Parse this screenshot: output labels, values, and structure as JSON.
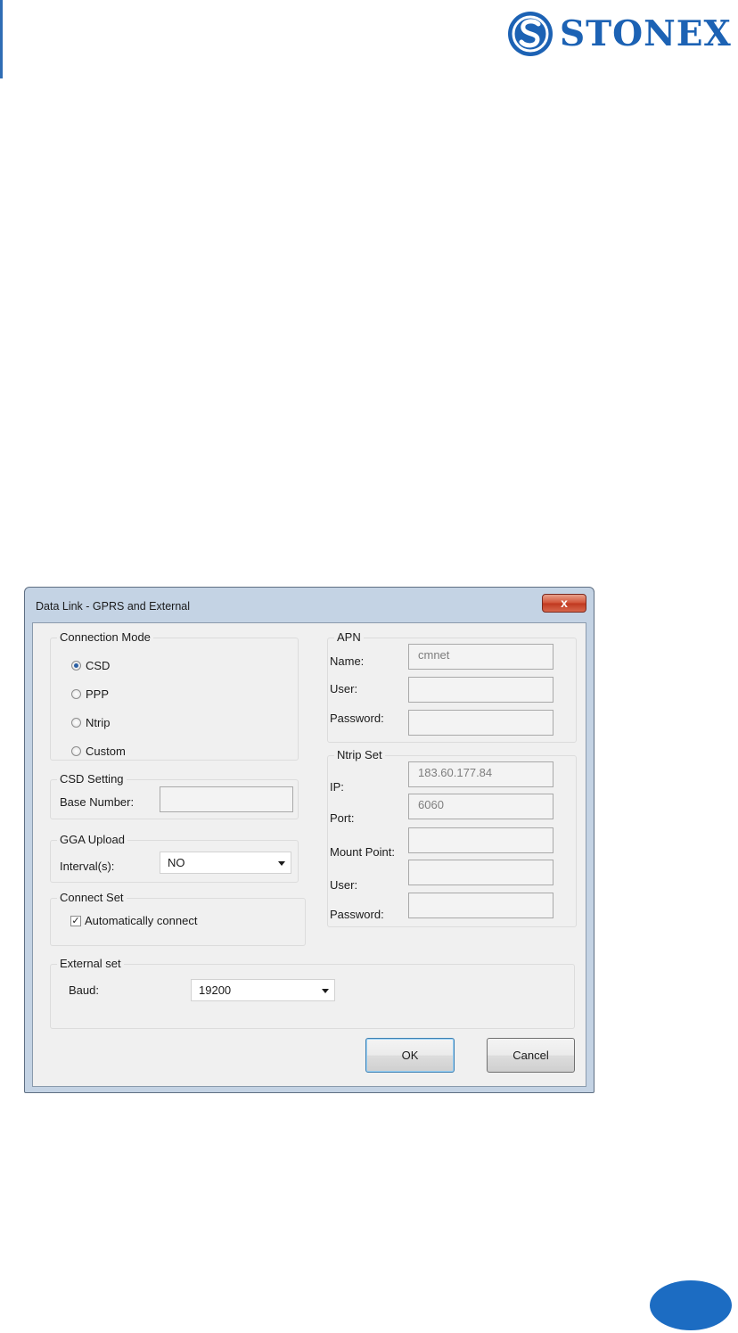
{
  "brand": {
    "name": "STONEX",
    "color": "#1c62b4"
  },
  "dialog": {
    "title": "Data Link - GPRS and External",
    "close_glyph": "x",
    "connection_mode": {
      "legend": "Connection Mode",
      "options": [
        "CSD",
        "PPP",
        "Ntrip",
        "Custom"
      ],
      "selected": "CSD"
    },
    "csd_setting": {
      "legend": "CSD Setting",
      "base_number_label": "Base Number:",
      "base_number_value": ""
    },
    "gga_upload": {
      "legend": "GGA Upload",
      "interval_label": "Interval(s):",
      "interval_value": "NO"
    },
    "connect_set": {
      "legend": "Connect Set",
      "auto_connect_label": "Automatically connect",
      "auto_connect_checked": true,
      "check_glyph": "✓"
    },
    "apn": {
      "legend": "APN",
      "name_label": "Name:",
      "name_value": "cmnet",
      "user_label": "User:",
      "user_value": "",
      "password_label": "Password:",
      "password_value": ""
    },
    "ntrip_set": {
      "legend": "Ntrip Set",
      "ip_label": "IP:",
      "ip_value": "183.60.177.84",
      "port_label": "Port:",
      "port_value": "6060",
      "mount_point_label": "Mount Point:",
      "mount_point_value": "",
      "user_label": "User:",
      "user_value": "",
      "password_label": "Password:",
      "password_value": ""
    },
    "external_set": {
      "legend": "External set",
      "baud_label": "Baud:",
      "baud_value": "19200"
    },
    "buttons": {
      "ok": "OK",
      "cancel": "Cancel"
    }
  }
}
